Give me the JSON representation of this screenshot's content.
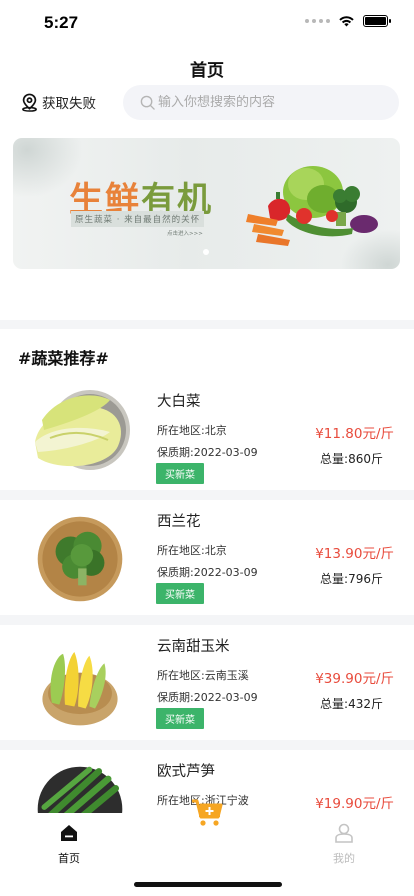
{
  "status": {
    "time": "5:27"
  },
  "nav": {
    "title": "首页"
  },
  "location": {
    "label": "获取失败",
    "icon": "location-pin-icon"
  },
  "search": {
    "placeholder": "输入你想搜索的内容",
    "icon": "search-icon"
  },
  "banner": {
    "title_part1": "生鲜",
    "title_part2": "有机",
    "subtitle": "原生蔬菜 · 来自最自然的关怀",
    "sub_small": "点击进入>>>",
    "colors": {
      "orange": "#e8823a",
      "green": "#7a9b3c"
    }
  },
  "section": {
    "title": "#蔬菜推荐#"
  },
  "products": [
    {
      "name": "大白菜",
      "region": "所在地区:北京",
      "shelf": "保质期:2022-03-09",
      "button": "买新菜",
      "price": "¥11.80元/斤",
      "total": "总量:860斤",
      "image": "napa-cabbage-image"
    },
    {
      "name": "西兰花",
      "region": "所在地区:北京",
      "shelf": "保质期:2022-03-09",
      "button": "买新菜",
      "price": "¥13.90元/斤",
      "total": "总量:796斤",
      "image": "broccoli-image"
    },
    {
      "name": "云南甜玉米",
      "region": "所在地区:云南玉溪",
      "shelf": "保质期:2022-03-09",
      "button": "买新菜",
      "price": "¥39.90元/斤",
      "total": "总量:432斤",
      "image": "corn-image"
    },
    {
      "name": "欧式芦笋",
      "region": "所在地区:浙江宁波",
      "shelf": "",
      "button": "",
      "price": "¥19.90元/斤",
      "total": "",
      "image": "asparagus-image"
    }
  ],
  "tabbar": {
    "home_label": "首页",
    "mine_label": "我的",
    "cart_icon": "cart-plus-icon"
  },
  "theme": {
    "price_color": "#e84b3c",
    "button_color": "#3cb46a",
    "cart_color": "#f6a623"
  }
}
